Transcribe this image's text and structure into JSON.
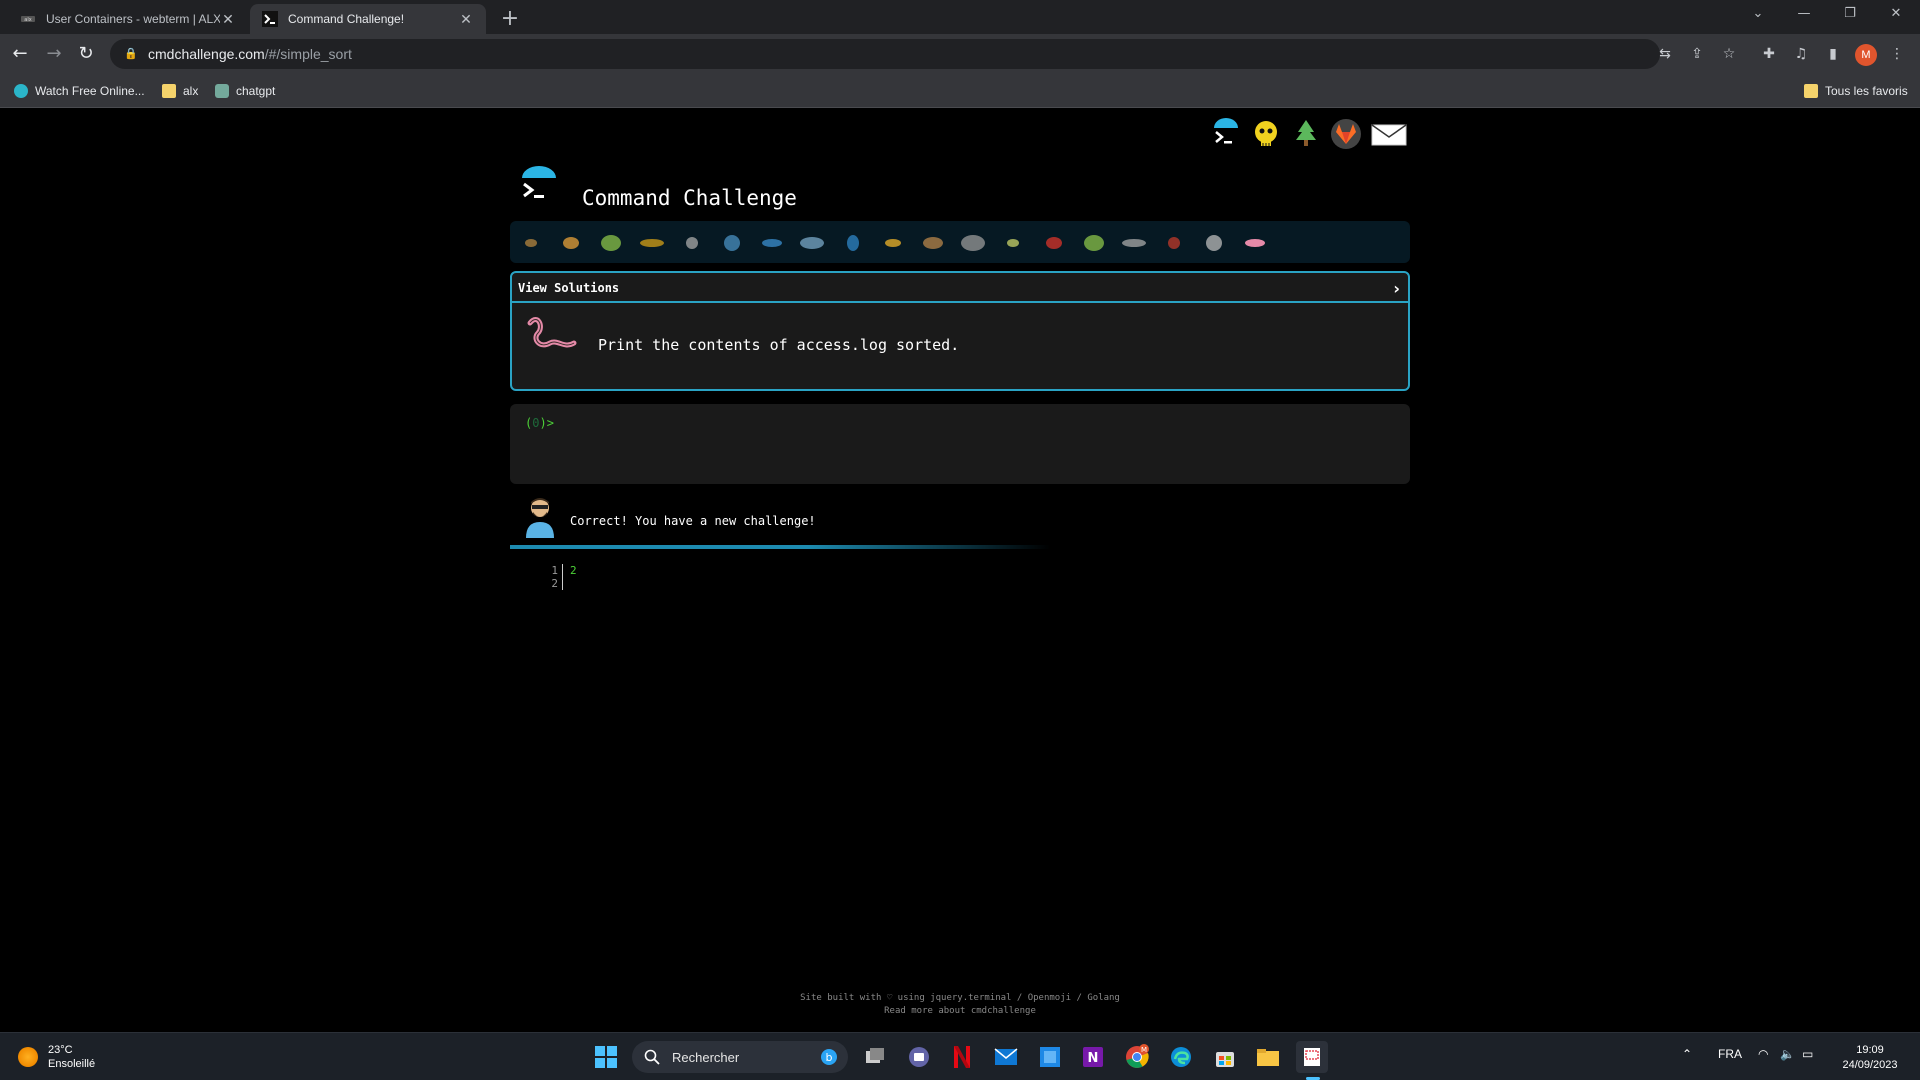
{
  "browser": {
    "tabs": [
      {
        "title": "User Containers - webterm | ALX",
        "active": false
      },
      {
        "title": "Command Challenge!",
        "active": true
      }
    ],
    "address": {
      "host": "cmdchallenge.com",
      "path": "/#/simple_sort"
    },
    "profile_initial": "M",
    "bookmarks": [
      {
        "label": "Watch Free Online...",
        "icon": "site-icon"
      },
      {
        "label": "alx",
        "icon": "folder-icon"
      },
      {
        "label": "chatgpt",
        "icon": "chatgpt-icon"
      }
    ],
    "all_bookmarks_label": "Tous les favoris"
  },
  "page": {
    "site_title": "Command Challenge",
    "top_icons": [
      "terminal-icon",
      "skull-icon",
      "tree-icon",
      "gitlab-icon",
      "mail-icon"
    ],
    "animals": [
      "snail",
      "butterfly",
      "caterpillar",
      "ant",
      "spider",
      "shark",
      "dolphin",
      "dolphin-2",
      "fish",
      "tropical-fish",
      "hedgehog",
      "wolf",
      "mosquito",
      "lady-beetle",
      "worm",
      "insect",
      "scorpion",
      "fly",
      "worm-2"
    ],
    "challenge": {
      "view_solutions_label": "View Solutions",
      "text": "Print the contents of access.log sorted."
    },
    "terminal": {
      "prompt_prefix": "(",
      "prompt_count": "0",
      "prompt_suffix": ")>"
    },
    "feedback": {
      "message": "Correct! You have a new challenge!",
      "progress": 0.6
    },
    "code": {
      "line_numbers": [
        "1",
        "2"
      ],
      "lines": [
        "2",
        ""
      ]
    },
    "footer": {
      "line1": "Site built with ♡ using jquery.terminal / Openmoji / Golang",
      "line2": "Read more about cmdchallenge"
    }
  },
  "taskbar": {
    "weather_temp": "23°C",
    "weather_desc": "Ensoleillé",
    "search_placeholder": "Rechercher",
    "language": "FRA",
    "time": "19:09",
    "date": "24/09/2023",
    "chrome_badge": "M"
  }
}
